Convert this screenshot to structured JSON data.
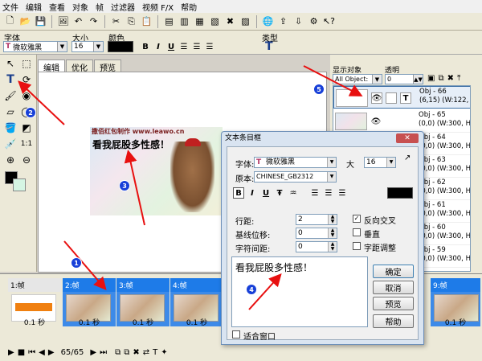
{
  "menu": [
    "文件",
    "编辑",
    "查看",
    "对象",
    "帧",
    "过滤器",
    "视频 F/X",
    "帮助"
  ],
  "fontbar": {
    "font_label": "字体",
    "font_value": "微软雅黑",
    "size_label": "大小",
    "size_value": "16",
    "color_label": "颜色",
    "type_label": "类型",
    "bold": "B",
    "italic": "I",
    "underline": "U"
  },
  "tabs": [
    "编辑",
    "优化",
    "预览"
  ],
  "canvas": {
    "watermark": "撒佰红包制作 www.leawo.cn",
    "text": "看我屁股多性感！"
  },
  "right_panel": {
    "show_label": "显示对象",
    "trans_label": "透明",
    "show_value": "All Object:",
    "trans_value": "0",
    "objects": [
      {
        "name": "Obj - 66",
        "info": "(6,15) (W:122, H"
      },
      {
        "name": "Obj - 65",
        "info": "(0,0) (W:300, H:"
      },
      {
        "name": "Obj - 64",
        "info": "(0,0) (W:300, H:"
      },
      {
        "name": "Obj - 63",
        "info": "(0,0) (W:300, H:"
      },
      {
        "name": "Obj - 62",
        "info": "(0,0) (W:300, H:"
      },
      {
        "name": "Obj - 61",
        "info": "(0,0) (W:300, H:"
      },
      {
        "name": "Obj - 60",
        "info": "(0,0) (W:300, H:"
      },
      {
        "name": "Obj - 59",
        "info": "(0,0) (W:300, H:"
      }
    ]
  },
  "timeline": {
    "frames": [
      {
        "header": "1:帧",
        "time": "0.1 秒"
      },
      {
        "header": "2:帧",
        "time": "0.1 秒"
      },
      {
        "header": "3:帧",
        "time": "0.1 秒"
      },
      {
        "header": "4:帧",
        "time": "0.1 秒"
      },
      {
        "header": "9:帧",
        "time": "0.1 秒"
      }
    ]
  },
  "bottombar": {
    "counter": "65/65"
  },
  "dialog": {
    "title": "文本条目框",
    "font_label": "字体:",
    "font_value": "微软雅黑",
    "size_label": "大",
    "size_value": "16",
    "charset_label": "原本:",
    "charset_value": "CHINESE_GB2312",
    "line_label": "行距:",
    "line_value": "2",
    "baseline_label": "基线位移:",
    "baseline_value": "0",
    "charspace_label": "字符间距:",
    "charspace_value": "0",
    "antialias_label": "反向交叉",
    "vertical_label": "垂直",
    "spacing_label": "字距调整",
    "text_content": "看我屁股多性感！",
    "fit_label": "适合窗口",
    "ok": "确定",
    "cancel": "取消",
    "preview": "预览",
    "help": "帮助"
  },
  "annotations": [
    "1",
    "2",
    "3",
    "4",
    "5"
  ]
}
